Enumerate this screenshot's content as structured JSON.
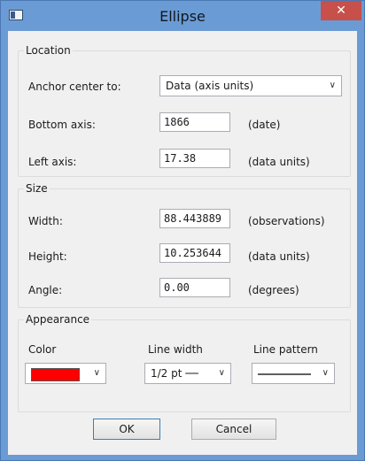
{
  "window": {
    "title": "Ellipse",
    "close_glyph": "✕"
  },
  "location": {
    "legend": "Location",
    "anchor_label": "Anchor center to:",
    "anchor_value": "Data (axis units)",
    "bottom_label": "Bottom axis:",
    "bottom_value": "1866",
    "bottom_unit": "(date)",
    "left_label": "Left axis:",
    "left_value": "17.38",
    "left_unit": "(data units)"
  },
  "size": {
    "legend": "Size",
    "width_label": "Width:",
    "width_value": "88.443889",
    "width_unit": "(observations)",
    "height_label": "Height:",
    "height_value": "10.253644",
    "height_unit": "(data units)",
    "angle_label": "Angle:",
    "angle_value": "0.00",
    "angle_unit": "(degrees)"
  },
  "appearance": {
    "legend": "Appearance",
    "color_label": "Color",
    "color_value": "#ff0000",
    "line_width_label": "Line width",
    "line_width_value": "1/2 pt ──",
    "line_pattern_label": "Line pattern",
    "line_pattern_value": "solid"
  },
  "buttons": {
    "ok": "OK",
    "cancel": "Cancel"
  },
  "icons": {
    "dropdown": "chevron-down-icon",
    "app": "app-window-icon",
    "close": "close-icon"
  }
}
